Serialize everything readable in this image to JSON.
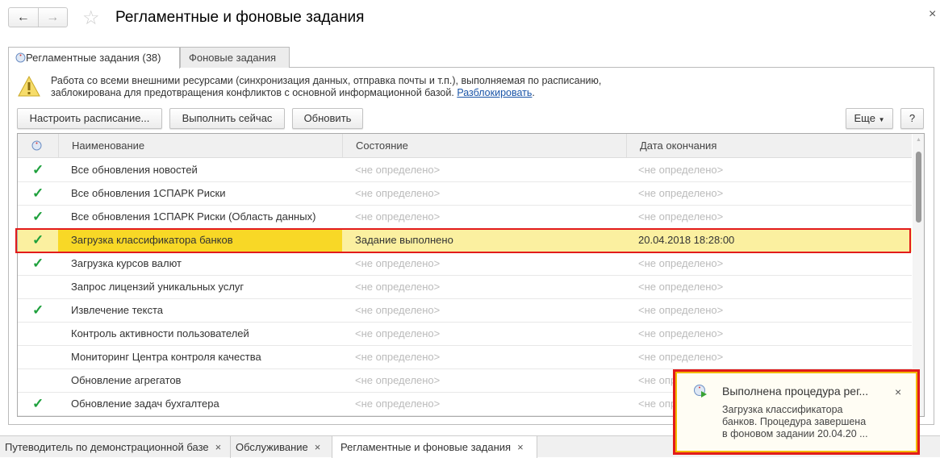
{
  "window": {
    "title": "Регламентные и фоновые задания",
    "close": "×"
  },
  "nav": {
    "back": "←",
    "forward": "→",
    "star": "☆"
  },
  "tabs": [
    {
      "label": "Регламентные задания (38)"
    },
    {
      "label": "Фоновые задания"
    }
  ],
  "warning": {
    "line1": "Работа со всеми внешними ресурсами (синхронизация данных, отправка почты и т.п.), выполняемая по расписанию,",
    "line2": "заблокирована для предотвращения конфликтов с основной информационной базой.",
    "link": "Разблокировать",
    "end": "."
  },
  "toolbar": {
    "schedule": "Настроить расписание...",
    "run_now": "Выполнить сейчас",
    "refresh": "Обновить",
    "more": "Еще",
    "help": "?"
  },
  "grid": {
    "columns": [
      "Наименование",
      "Состояние",
      "Дата окончания"
    ],
    "rows": [
      {
        "check": "✓",
        "name": "Все обновления новостей",
        "state": "<не определено>",
        "date": "<не определено>"
      },
      {
        "check": "✓",
        "name": "Все обновления 1СПАРК Риски",
        "state": "<не определено>",
        "date": "<не определено>"
      },
      {
        "check": "✓",
        "name": "Все обновления 1СПАРК Риски (Область данных)",
        "state": "<не определено>",
        "date": "<не определено>"
      },
      {
        "check": "✓",
        "name": "Загрузка классификатора банков",
        "state": "Задание выполнено",
        "date": "20.04.2018 18:28:00",
        "selected": true
      },
      {
        "check": "✓",
        "name": "Загрузка курсов валют",
        "state": "<не определено>",
        "date": "<не определено>"
      },
      {
        "check": "",
        "name": "Запрос лицензий уникальных услуг",
        "state": "<не определено>",
        "date": "<не определено>"
      },
      {
        "check": "✓",
        "name": "Извлечение текста",
        "state": "<не определено>",
        "date": "<не определено>"
      },
      {
        "check": "",
        "name": "Контроль активности пользователей",
        "state": "<не определено>",
        "date": "<не определено>"
      },
      {
        "check": "",
        "name": "Мониторинг Центра контроля качества",
        "state": "<не определено>",
        "date": "<не определено>"
      },
      {
        "check": "",
        "name": "Обновление агрегатов",
        "state": "<не определено>",
        "date": "<не определено>"
      },
      {
        "check": "✓",
        "name": "Обновление задач бухгалтера",
        "state": "<не определено>",
        "date": "<не определено>"
      }
    ]
  },
  "bottom_tabs": [
    {
      "label": "Путеводитель по демонстрационной базе"
    },
    {
      "label": "Обслуживание"
    },
    {
      "label": "Регламентные и фоновые задания"
    }
  ],
  "notification": {
    "title": "Выполнена процедура рег...",
    "line1": "Загрузка классификатора",
    "line2": "банков. Процедура завершена",
    "line3": "в фоновом задании 20.04.20 ...",
    "close": "×"
  }
}
